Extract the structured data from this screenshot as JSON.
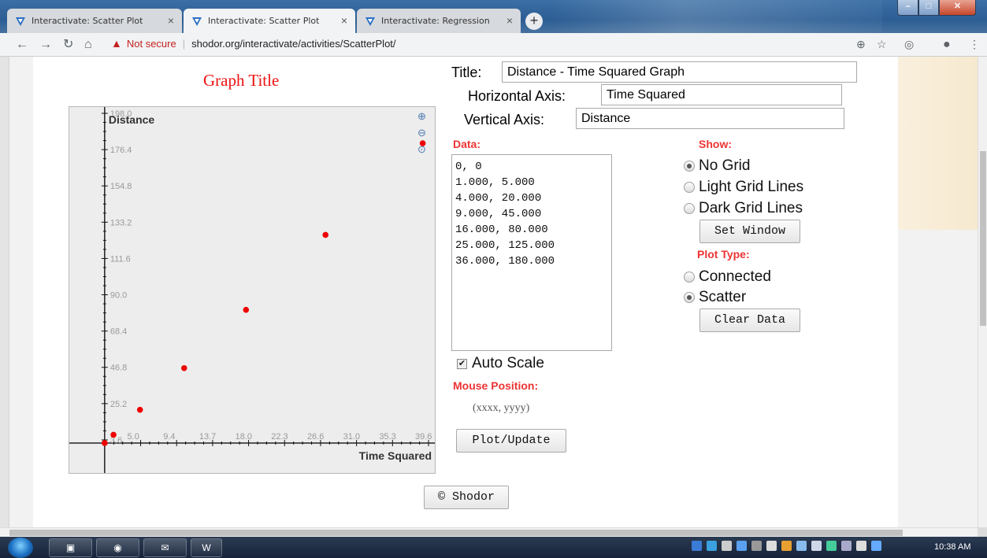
{
  "browser": {
    "tabs": [
      {
        "label": "Interactivate: Scatter Plot",
        "active": false
      },
      {
        "label": "Interactivate: Scatter Plot",
        "active": true
      },
      {
        "label": "Interactivate: Regression",
        "active": false
      }
    ],
    "new_tab_icon": "plus-icon",
    "security_label": "Not secure",
    "url": "shodor.org/interactivate/activities/ScatterPlot/",
    "accent_color": "#3c6fa5"
  },
  "app": {
    "graph_title": "Graph Title",
    "title_label": "Title:",
    "title_value": "Distance - Time Squared Graph",
    "horizontal_label": "Horizontal Axis:",
    "horizontal_value": "Time Squared",
    "vertical_label": "Vertical Axis:",
    "vertical_value": "Distance",
    "data_label": "Data:",
    "data_lines": [
      "0, 0",
      "1.000, 5.000",
      "4.000, 20.000",
      "9.000, 45.000",
      "16.000, 80.000",
      "25.000, 125.000",
      "36.000, 180.000"
    ],
    "show_label": "Show:",
    "grid_options": [
      {
        "label": "No Grid",
        "selected": true
      },
      {
        "label": "Light Grid Lines",
        "selected": false
      },
      {
        "label": "Dark Grid Lines",
        "selected": false
      }
    ],
    "set_window_label": "Set Window",
    "plot_type_label": "Plot Type:",
    "plot_types": [
      {
        "label": "Connected",
        "selected": false
      },
      {
        "label": "Scatter",
        "selected": true
      }
    ],
    "clear_data_label": "Clear Data",
    "auto_scale_label": "Auto Scale",
    "auto_scale_checked": true,
    "mouse_position_label": "Mouse Position:",
    "mouse_position_value": "(xxxx, yyyy)",
    "plot_update_label": "Plot/Update",
    "copyright_label": "© Shodor",
    "title_color": "#ee1111",
    "label_color": "#ee3333",
    "point_color": "#ee0000"
  },
  "chart_data": {
    "type": "scatter",
    "xlabel": "Time Squared",
    "ylabel": "Distance",
    "x": [
      0,
      1,
      4,
      9,
      16,
      25,
      36
    ],
    "y": [
      0,
      5,
      20,
      45,
      80,
      125,
      180
    ],
    "xlim": [
      -0.7,
      39.6
    ],
    "ylim": [
      -3.8,
      198.0
    ],
    "x_ticks": [
      "5.0",
      "9.4",
      "13.7",
      "18.0",
      "22.3",
      "26.6",
      "31.0",
      "35.3",
      "39.6"
    ],
    "y_ticks": [
      "198.0",
      "176.4",
      "154.8",
      "133.2",
      "111.6",
      "90.0",
      "68.4",
      "46.8",
      "25.2",
      "3.6"
    ],
    "grid": false,
    "zoom_icons": [
      "zoom-in-icon",
      "zoom-out-icon",
      "zoom-reset-icon"
    ]
  },
  "taskbar": {
    "clock": "10:38 AM"
  }
}
